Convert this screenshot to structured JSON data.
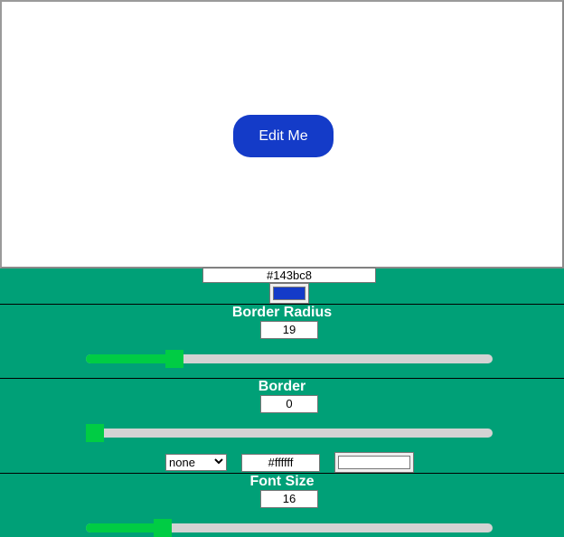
{
  "preview": {
    "button_label": "Edit Me",
    "background_color": "#143bc8",
    "border_radius": 19,
    "font_size": 16,
    "text_color": "#ffffff"
  },
  "background": {
    "hex_value": "#143bc8",
    "swatch_color": "#143bc8"
  },
  "border_radius": {
    "title": "Border Radius",
    "value": "19",
    "slider_fraction": 0.205
  },
  "border": {
    "title": "Border",
    "value": "0",
    "slider_fraction": 0.0,
    "style_selected": "none",
    "color_hex": "#ffffff",
    "swatch_color": "#ffffff"
  },
  "font_size": {
    "title": "Font Size",
    "value": "16",
    "slider_fraction": 0.175
  },
  "icons": {
    "select_chevron": "chevron-down-icon"
  },
  "colors": {
    "panel_bg": "#00a077",
    "slider_accent": "#00cc44",
    "slider_track": "#d3d3d3"
  }
}
